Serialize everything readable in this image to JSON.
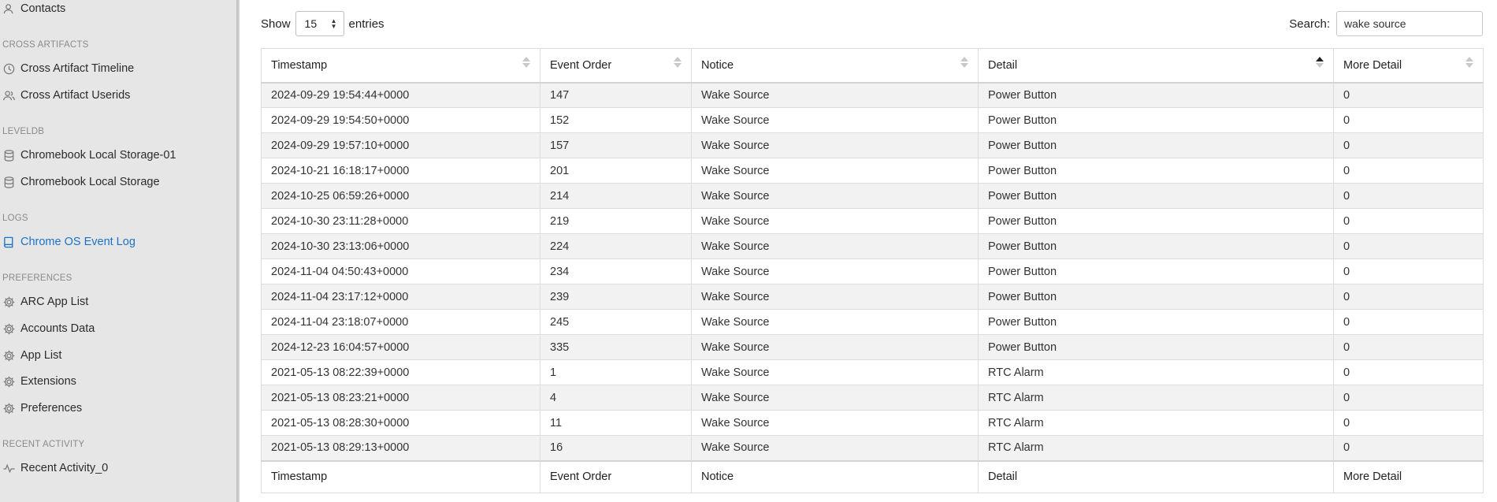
{
  "sidebar": {
    "items_top": [
      {
        "label": "Contacts",
        "icon": "contacts-icon"
      }
    ],
    "sections": [
      {
        "title": "CROSS ARTIFACTS",
        "items": [
          {
            "label": "Cross Artifact Timeline",
            "icon": "clock-icon"
          },
          {
            "label": "Cross Artifact Userids",
            "icon": "users-icon"
          }
        ]
      },
      {
        "title": "LEVELDB",
        "items": [
          {
            "label": "Chromebook Local Storage-01",
            "icon": "database-icon"
          },
          {
            "label": "Chromebook Local Storage",
            "icon": "database-icon"
          }
        ]
      },
      {
        "title": "LOGS",
        "items": [
          {
            "label": "Chrome OS Event Log",
            "icon": "book-icon",
            "active": true
          }
        ]
      },
      {
        "title": "PREFERENCES",
        "items": [
          {
            "label": "ARC App List",
            "icon": "gear-icon"
          },
          {
            "label": "Accounts Data",
            "icon": "gear-icon"
          },
          {
            "label": "App List",
            "icon": "gear-icon"
          },
          {
            "label": "Extensions",
            "icon": "gear-icon"
          },
          {
            "label": "Preferences",
            "icon": "gear-icon"
          }
        ]
      },
      {
        "title": "RECENT ACTIVITY",
        "items": [
          {
            "label": "Recent Activity_0",
            "icon": "activity-icon"
          }
        ]
      }
    ],
    "active_color": "#1a73c8"
  },
  "controls": {
    "show_label": "Show",
    "entries_value": "15",
    "entries_label": "entries",
    "search_label": "Search:",
    "search_value": "wake source"
  },
  "table": {
    "columns": [
      "Timestamp",
      "Event Order",
      "Notice",
      "Detail",
      "More Detail"
    ],
    "sorted_column": "Detail",
    "sort_direction": "ascending",
    "rows": [
      [
        "2024-09-29 19:54:44+0000",
        "147",
        "Wake Source",
        "Power Button",
        "0"
      ],
      [
        "2024-09-29 19:54:50+0000",
        "152",
        "Wake Source",
        "Power Button",
        "0"
      ],
      [
        "2024-09-29 19:57:10+0000",
        "157",
        "Wake Source",
        "Power Button",
        "0"
      ],
      [
        "2024-10-21 16:18:17+0000",
        "201",
        "Wake Source",
        "Power Button",
        "0"
      ],
      [
        "2024-10-25 06:59:26+0000",
        "214",
        "Wake Source",
        "Power Button",
        "0"
      ],
      [
        "2024-10-30 23:11:28+0000",
        "219",
        "Wake Source",
        "Power Button",
        "0"
      ],
      [
        "2024-10-30 23:13:06+0000",
        "224",
        "Wake Source",
        "Power Button",
        "0"
      ],
      [
        "2024-11-04 04:50:43+0000",
        "234",
        "Wake Source",
        "Power Button",
        "0"
      ],
      [
        "2024-11-04 23:17:12+0000",
        "239",
        "Wake Source",
        "Power Button",
        "0"
      ],
      [
        "2024-11-04 23:18:07+0000",
        "245",
        "Wake Source",
        "Power Button",
        "0"
      ],
      [
        "2024-12-23 16:04:57+0000",
        "335",
        "Wake Source",
        "Power Button",
        "0"
      ],
      [
        "2021-05-13 08:22:39+0000",
        "1",
        "Wake Source",
        "RTC Alarm",
        "0"
      ],
      [
        "2021-05-13 08:23:21+0000",
        "4",
        "Wake Source",
        "RTC Alarm",
        "0"
      ],
      [
        "2021-05-13 08:28:30+0000",
        "11",
        "Wake Source",
        "RTC Alarm",
        "0"
      ],
      [
        "2021-05-13 08:29:13+0000",
        "16",
        "Wake Source",
        "RTC Alarm",
        "0"
      ]
    ]
  }
}
